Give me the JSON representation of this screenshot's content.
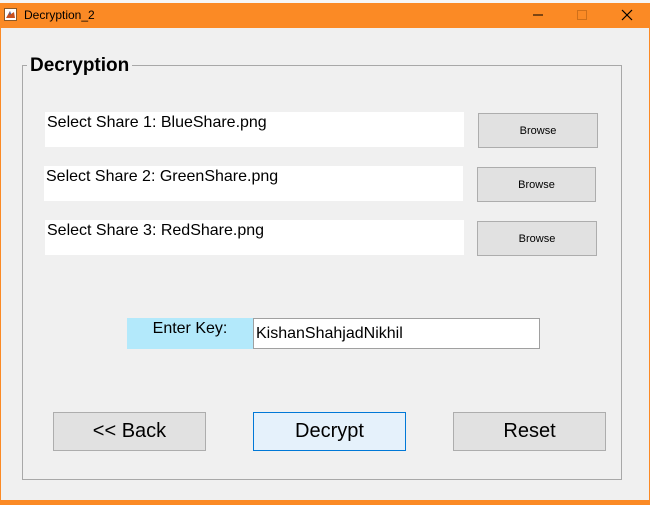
{
  "window": {
    "title": "Decryption_2",
    "icon": "matlab-figure-icon",
    "controls": [
      "minimize-icon",
      "maximize-icon",
      "close-icon"
    ],
    "accent_color": "#fb8a25"
  },
  "panel": {
    "title": "Decryption"
  },
  "shares": [
    {
      "label": "Select Share 1: BlueShare.png",
      "button": "Browse"
    },
    {
      "label": "Select Share 2: GreenShare.png",
      "button": "Browse"
    },
    {
      "label": "Select Share 3: RedShare.png",
      "button": "Browse"
    }
  ],
  "key": {
    "label": "Enter Key:",
    "value": "KishanShahjadNikhil",
    "label_color": "#b3e9fb"
  },
  "actions": {
    "back": "<< Back",
    "decrypt": "Decrypt",
    "reset": "Reset"
  }
}
